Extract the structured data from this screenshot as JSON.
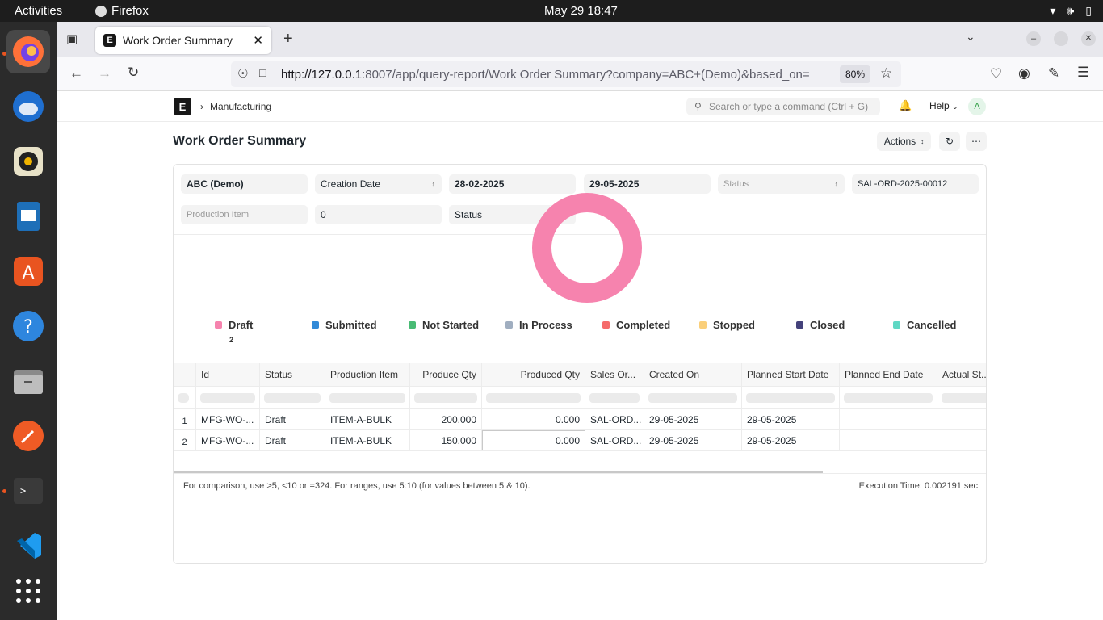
{
  "os": {
    "activities": "Activities",
    "app_name": "Firefox",
    "clock": "May 29  18:47"
  },
  "browser": {
    "tab_title": "Work Order Summary",
    "url_host": "http://127.0.0.1",
    "url_rest": ":8007/app/query-report/Work Order Summary?company=ABC+(Demo)&based_on=",
    "zoom": "80%"
  },
  "app": {
    "breadcrumb": "Manufacturing",
    "search_placeholder": "Search or type a command (Ctrl + G)",
    "help_label": "Help",
    "avatar_initial": "A",
    "page_title": "Work Order Summary",
    "actions_label": "Actions"
  },
  "filters": {
    "company": "ABC (Demo)",
    "based_on": "Creation Date",
    "from_date": "28-02-2025",
    "to_date": "29-05-2025",
    "status_placeholder": "Status",
    "sales_order": "SAL-ORD-2025-00012",
    "production_item_placeholder": "Production Item",
    "age": "0",
    "charts_based_on": "Status"
  },
  "chart_data": {
    "type": "pie",
    "categories": [
      "Draft",
      "Submitted",
      "Not Started",
      "In Process",
      "Completed",
      "Stopped",
      "Closed",
      "Cancelled"
    ],
    "values": [
      2,
      0,
      0,
      0,
      0,
      0,
      0,
      0
    ],
    "colors": [
      "#f683ae",
      "#318ad8",
      "#48bb74",
      "#a0aec0",
      "#f56b6b",
      "#facf7a",
      "#44427b",
      "#5fd8c4"
    ],
    "legend_count": "2",
    "donut": true
  },
  "table": {
    "columns": [
      "Id",
      "Status",
      "Production Item",
      "Produce Qty",
      "Produced Qty",
      "Sales Or...",
      "Created On",
      "Planned Start Date",
      "Planned End Date",
      "Actual St..."
    ],
    "rows": [
      [
        "1",
        "MFG-WO-...",
        "Draft",
        "ITEM-A-BULK",
        "200.000",
        "0.000",
        "SAL-ORD...",
        "29-05-2025",
        "29-05-2025",
        "",
        ""
      ],
      [
        "2",
        "MFG-WO-...",
        "Draft",
        "ITEM-A-BULK",
        "150.000",
        "0.000",
        "SAL-ORD...",
        "29-05-2025",
        "29-05-2025",
        "",
        ""
      ]
    ]
  },
  "footer": {
    "hint": "For comparison, use >5, <10 or =324. For ranges, use 5:10 (for values between 5 & 10).",
    "execution_time": "Execution Time: 0.002191 sec"
  }
}
